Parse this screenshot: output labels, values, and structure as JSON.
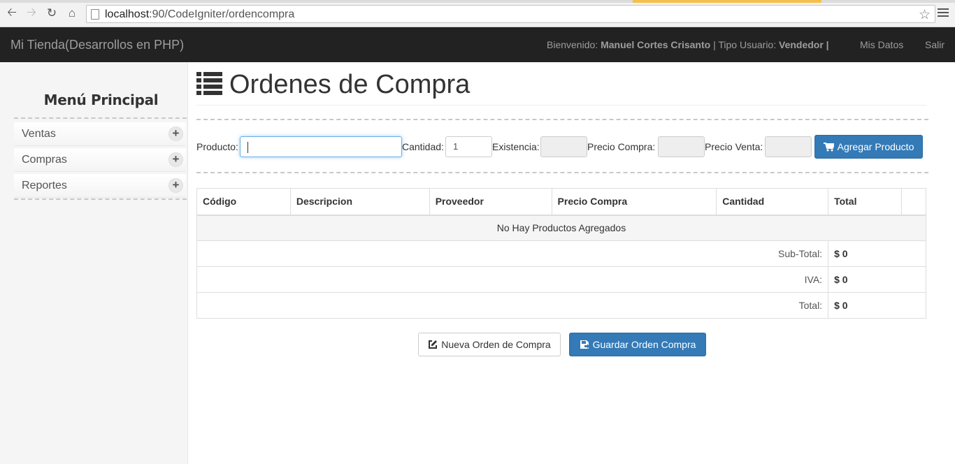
{
  "browser": {
    "url_host": "localhost",
    "url_rest": ":90/CodeIgniter/ordencompra"
  },
  "navbar": {
    "brand": "Mi Tienda(Desarrollos en PHP)",
    "welcome_prefix": "Bienvenido:",
    "user_name": "Manuel Cortes Crisanto",
    "type_prefix": "| Tipo Usuario:",
    "user_type": "Vendedor |",
    "links": [
      "Mis Datos",
      "Salir"
    ]
  },
  "sidebar": {
    "title": "Menú Principal",
    "items": [
      {
        "label": "Ventas",
        "icon": "plus-icon"
      },
      {
        "label": "Compras",
        "icon": "plus-icon"
      },
      {
        "label": "Reportes",
        "icon": "plus-icon"
      }
    ]
  },
  "main": {
    "title": "Ordenes de Compra",
    "title_icon": "list-icon",
    "form": {
      "producto_label": "Producto:",
      "producto_value": "",
      "cantidad_label": "Cantidad:",
      "cantidad_value": "1",
      "existencia_label": "Existencia:",
      "existencia_value": "",
      "precio_compra_label": "Precio Compra:",
      "precio_compra_value": "",
      "precio_venta_label": "Precio Venta:",
      "precio_venta_value": "",
      "add_button": "Agregar Producto",
      "add_button_icon": "shopping-cart-icon"
    },
    "table": {
      "headers": [
        "Código",
        "Descripcion",
        "Proveedor",
        "Precio Compra",
        "Cantidad",
        "Total",
        ""
      ],
      "empty_message": "No Hay Productos Agregados",
      "subtotal_label": "Sub-Total:",
      "subtotal_value": "$ 0",
      "iva_label": "IVA:",
      "iva_value": "$ 0",
      "total_label": "Total:",
      "total_value": "$ 0"
    },
    "buttons": {
      "new_order": "Nueva Orden de Compra",
      "new_order_icon": "edit-icon",
      "save_order": "Guardar Orden Compra",
      "save_order_icon": "save-icon"
    }
  },
  "colors": {
    "navbar_bg": "#222222",
    "primary": "#337ab7",
    "sidebar_bg": "#f5f5f5"
  }
}
